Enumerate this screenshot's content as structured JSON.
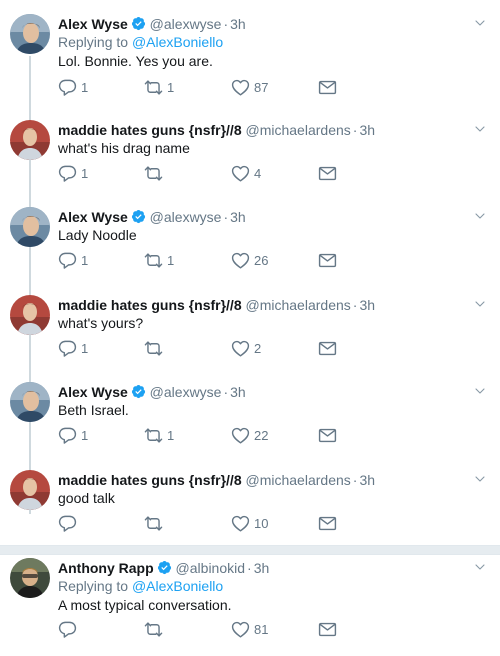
{
  "colors": {
    "link": "#1da1f2",
    "muted": "#657786",
    "line": "#cfd9de"
  },
  "tweets": [
    {
      "name": "Alex Wyse",
      "handle": "@alexwyse",
      "time": "3h",
      "replying_prefix": "Replying to",
      "replying_to": "@AlexBoniello",
      "text": "Lol. Bonnie. Yes you are.",
      "replies": "1",
      "retweets": "1",
      "likes": "87"
    },
    {
      "name": "maddie hates guns {nsfr}//8",
      "handle": "@michaelardens",
      "time": "3h",
      "text": "what's his drag name",
      "replies": "1",
      "retweets": "",
      "likes": "4"
    },
    {
      "name": "Alex Wyse",
      "handle": "@alexwyse",
      "time": "3h",
      "text": "Lady Noodle",
      "replies": "1",
      "retweets": "1",
      "likes": "26"
    },
    {
      "name": "maddie hates guns {nsfr}//8",
      "handle": "@michaelardens",
      "time": "3h",
      "text": "what's yours?",
      "replies": "1",
      "retweets": "",
      "likes": "2"
    },
    {
      "name": "Alex Wyse",
      "handle": "@alexwyse",
      "time": "3h",
      "text": "Beth Israel.",
      "replies": "1",
      "retweets": "1",
      "likes": "22"
    },
    {
      "name": "maddie hates guns {nsfr}//8",
      "handle": "@michaelardens",
      "time": "3h",
      "text": "good talk",
      "replies": "",
      "retweets": "",
      "likes": "10"
    },
    {
      "name": "Anthony Rapp",
      "handle": "@albinokid",
      "time": "3h",
      "replying_prefix": "Replying to",
      "replying_to": "@AlexBoniello",
      "text": "A most typical conversation.",
      "replies": "",
      "retweets": "",
      "likes": "81"
    }
  ]
}
